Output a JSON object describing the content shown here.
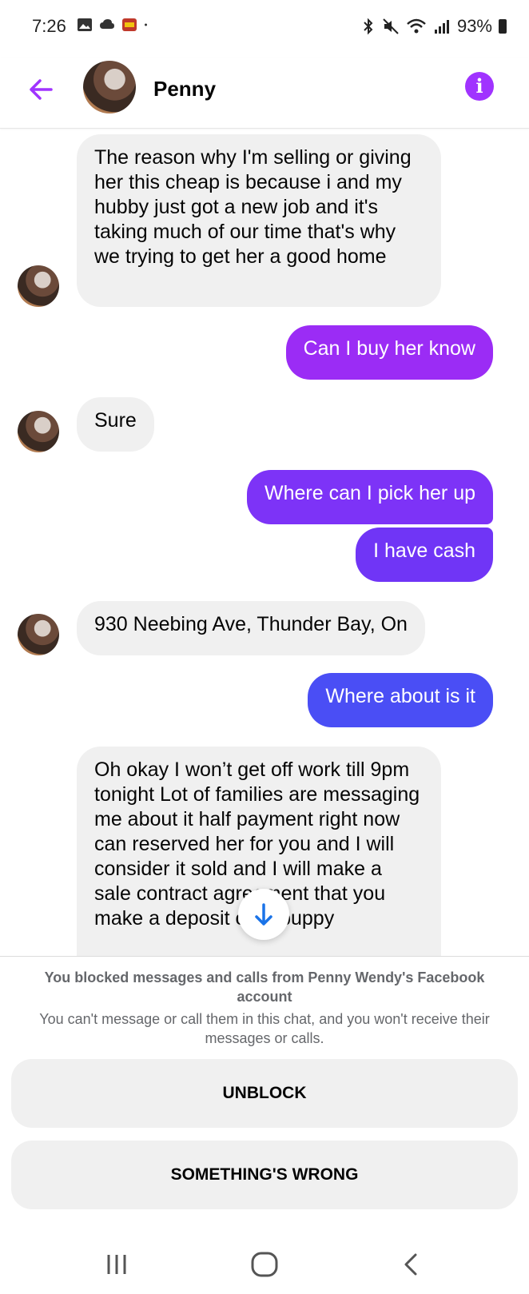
{
  "status_bar": {
    "time": "7:26",
    "battery": "93%"
  },
  "header": {
    "contact_name": "Penny",
    "accent_color": "#a033ff"
  },
  "messages": [
    {
      "from": "them",
      "text": "The reason why I'm selling or giving her this cheap is because i and my hubby just got a new job and it's taking much of our time that's why we trying to get her a good home"
    },
    {
      "from": "me",
      "text": "Can I buy her know",
      "color": "#9b2cf5"
    },
    {
      "from": "them",
      "text": "Sure"
    },
    {
      "from": "me",
      "text": "Where can I pick her up",
      "color": "#7d33f7"
    },
    {
      "from": "me",
      "text": "I have cash",
      "color": "#7035f6"
    },
    {
      "from": "them",
      "text": "930 Neebing Ave, Thunder Bay, On"
    },
    {
      "from": "me",
      "text": "Where about is it",
      "color": "#4a4ef5"
    },
    {
      "from": "them",
      "text": "Oh okay I won’t get off work till 9pm tonight Lot of families are messaging me about it half payment right now can reserved her for you and I will consider it sold and I will make a sale contract agreement that you make a deposit on a puppy"
    }
  ],
  "blocked_notice": {
    "title": "You blocked messages and calls from Penny Wendy's Facebook account",
    "subtitle": "You can't message or call them in this chat, and you won't receive their messages or calls."
  },
  "actions": {
    "unblock_label": "UNBLOCK",
    "something_wrong_label": "SOMETHING'S WRONG"
  }
}
